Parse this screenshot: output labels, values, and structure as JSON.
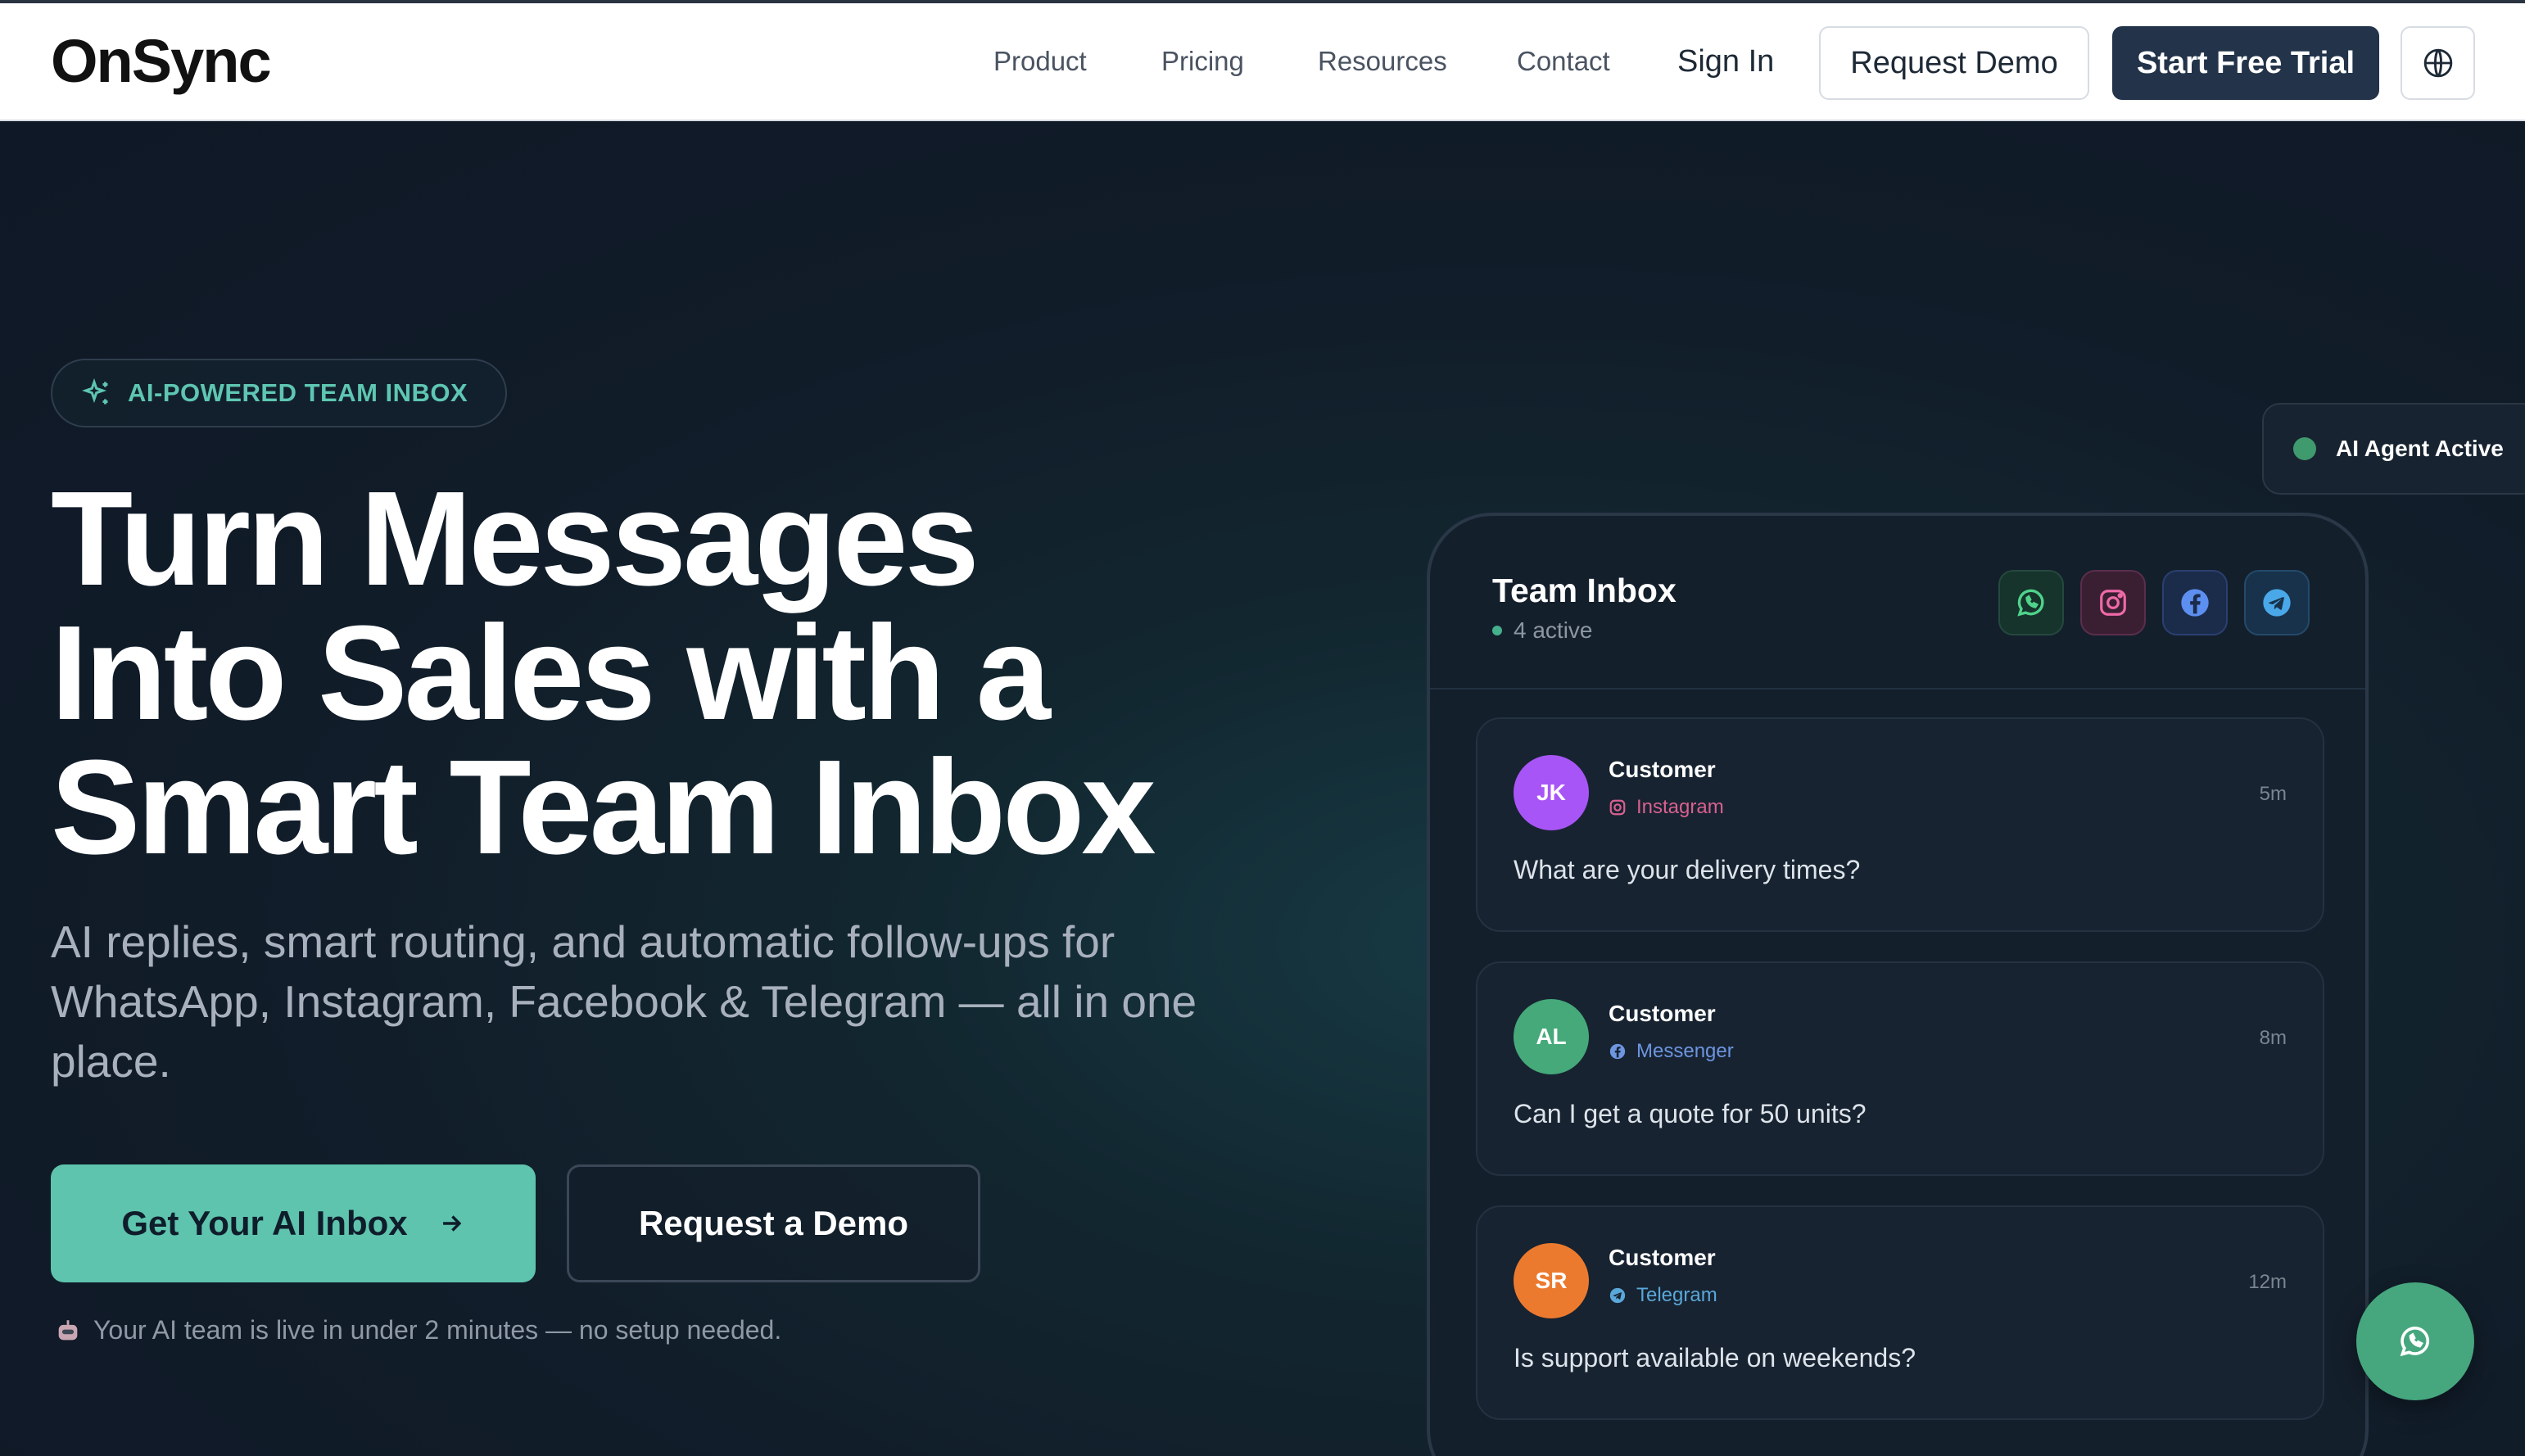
{
  "nav": {
    "logo": "OnSync",
    "links": [
      "Product",
      "Pricing",
      "Resources",
      "Contact"
    ],
    "sign_in": "Sign In",
    "request_demo": "Request Demo",
    "start_trial": "Start Free Trial",
    "language_icon": "globe-icon"
  },
  "hero": {
    "badge": "AI-POWERED TEAM INBOX",
    "headline_lines": [
      "Turn Messages",
      "Into Sales with a",
      "Smart Team Inbox"
    ],
    "subtitle": "AI replies, smart routing, and automatic follow-ups for WhatsApp, Instagram, Facebook & Telegram — all in one place.",
    "primary_cta": "Get Your AI Inbox",
    "secondary_cta": "Request a Demo",
    "note": "Your AI team is live in under 2 minutes — no setup needed."
  },
  "inbox": {
    "title": "Team Inbox",
    "active": "4 active",
    "channels": [
      "whatsapp-icon",
      "instagram-icon",
      "facebook-icon",
      "telegram-icon"
    ],
    "conversations": [
      {
        "initials": "JK",
        "name": "Customer",
        "source": "Instagram",
        "time": "5m",
        "message": "What are your delivery times?",
        "avatar_color": "#a855f7",
        "source_color": "#d9608f"
      },
      {
        "initials": "AL",
        "name": "Customer",
        "source": "Messenger",
        "time": "8m",
        "message": "Can I get a quote for 50 units?",
        "avatar_color": "#45a97a",
        "source_color": "#6d95e0"
      },
      {
        "initials": "SR",
        "name": "Customer",
        "source": "Telegram",
        "time": "12m",
        "message": "Is support available on weekends?",
        "avatar_color": "#ec7a2e",
        "source_color": "#5aa7d9"
      }
    ]
  },
  "ai_status": "AI Agent Active",
  "colors": {
    "accent": "#5ec4ae",
    "navy": "#22334a",
    "background": "#0f1a26"
  }
}
